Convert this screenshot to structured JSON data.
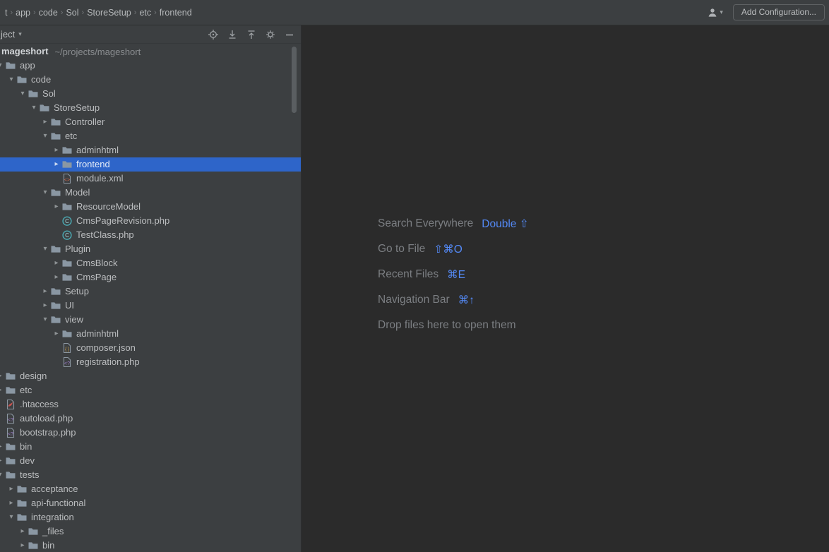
{
  "colors": {
    "panel_bg": "#3c3f41",
    "editor_bg": "#2b2b2b",
    "selection_blue": "#2e65c9",
    "shortcut_blue": "#548af7"
  },
  "breadcrumb": {
    "items": [
      "t",
      "app",
      "code",
      "Sol",
      "StoreSetup",
      "etc",
      "frontend"
    ]
  },
  "topbar": {
    "add_configuration_label": "Add Configuration..."
  },
  "project_panel": {
    "title": "ject",
    "actions": [
      "locate-icon",
      "expand-all-icon",
      "collapse-all-icon",
      "settings-icon",
      "hide-icon"
    ],
    "tree": [
      {
        "label": "mageshort",
        "path": "~/projects/mageshort",
        "level": 0,
        "icon": "none",
        "chev": "none",
        "root": true
      },
      {
        "label": "app",
        "level": 1,
        "icon": "folder",
        "chev": "expanded"
      },
      {
        "label": "code",
        "level": 2,
        "icon": "folder",
        "chev": "expanded"
      },
      {
        "label": "Sol",
        "level": 3,
        "icon": "folder",
        "chev": "expanded"
      },
      {
        "label": "StoreSetup",
        "level": 4,
        "icon": "folder",
        "chev": "expanded"
      },
      {
        "label": "Controller",
        "level": 5,
        "icon": "folder",
        "chev": "collapsed"
      },
      {
        "label": "etc",
        "level": 5,
        "icon": "folder",
        "chev": "expanded"
      },
      {
        "label": "adminhtml",
        "level": 6,
        "icon": "folder",
        "chev": "collapsed"
      },
      {
        "label": "frontend",
        "level": 6,
        "icon": "folder",
        "chev": "collapsed",
        "selected": true
      },
      {
        "label": "module.xml",
        "level": 6,
        "icon": "xml",
        "chev": "none"
      },
      {
        "label": "Model",
        "level": 5,
        "icon": "folder",
        "chev": "expanded"
      },
      {
        "label": "ResourceModel",
        "level": 6,
        "icon": "folder",
        "chev": "collapsed"
      },
      {
        "label": "CmsPageRevision.php",
        "level": 6,
        "icon": "phpclass",
        "chev": "none"
      },
      {
        "label": "TestClass.php",
        "level": 6,
        "icon": "phpclass",
        "chev": "none"
      },
      {
        "label": "Plugin",
        "level": 5,
        "icon": "folder",
        "chev": "expanded"
      },
      {
        "label": "CmsBlock",
        "level": 6,
        "icon": "folder",
        "chev": "collapsed"
      },
      {
        "label": "CmsPage",
        "level": 6,
        "icon": "folder",
        "chev": "collapsed"
      },
      {
        "label": "Setup",
        "level": 5,
        "icon": "folder",
        "chev": "collapsed"
      },
      {
        "label": "UI",
        "level": 5,
        "icon": "folder",
        "chev": "collapsed"
      },
      {
        "label": "view",
        "level": 5,
        "icon": "folder",
        "chev": "expanded"
      },
      {
        "label": "adminhtml",
        "level": 6,
        "icon": "folder",
        "chev": "collapsed"
      },
      {
        "label": "composer.json",
        "level": 6,
        "icon": "json",
        "chev": "none"
      },
      {
        "label": "registration.php",
        "level": 6,
        "icon": "php",
        "chev": "none"
      },
      {
        "label": "design",
        "level": 1,
        "icon": "folder",
        "chev": "collapsed"
      },
      {
        "label": "etc",
        "level": 1,
        "icon": "folder",
        "chev": "collapsed"
      },
      {
        "label": ".htaccess",
        "level": 1,
        "icon": "htaccess",
        "chev": "none"
      },
      {
        "label": "autoload.php",
        "level": 1,
        "icon": "php",
        "chev": "none"
      },
      {
        "label": "bootstrap.php",
        "level": 1,
        "icon": "php",
        "chev": "none"
      },
      {
        "label": "bin",
        "level": 1,
        "icon": "folder",
        "chev": "collapsed"
      },
      {
        "label": "dev",
        "level": 1,
        "icon": "folder",
        "chev": "collapsed"
      },
      {
        "label": "tests",
        "level": 1,
        "icon": "folder",
        "chev": "expanded"
      },
      {
        "label": "acceptance",
        "level": 2,
        "icon": "folder",
        "chev": "collapsed"
      },
      {
        "label": "api-functional",
        "level": 2,
        "icon": "folder",
        "chev": "collapsed"
      },
      {
        "label": "integration",
        "level": 2,
        "icon": "folder",
        "chev": "expanded"
      },
      {
        "label": "_files",
        "level": 3,
        "icon": "folder",
        "chev": "collapsed"
      },
      {
        "label": "bin",
        "level": 3,
        "icon": "folder",
        "chev": "collapsed"
      }
    ]
  },
  "editor": {
    "hints": [
      {
        "label": "Search Everywhere",
        "keys": "Double ⇧"
      },
      {
        "label": "Go to File",
        "keys": "⇧⌘O"
      },
      {
        "label": "Recent Files",
        "keys": "⌘E"
      },
      {
        "label": "Navigation Bar",
        "keys": "⌘↑"
      },
      {
        "label": "Drop files here to open them",
        "keys": ""
      }
    ]
  }
}
